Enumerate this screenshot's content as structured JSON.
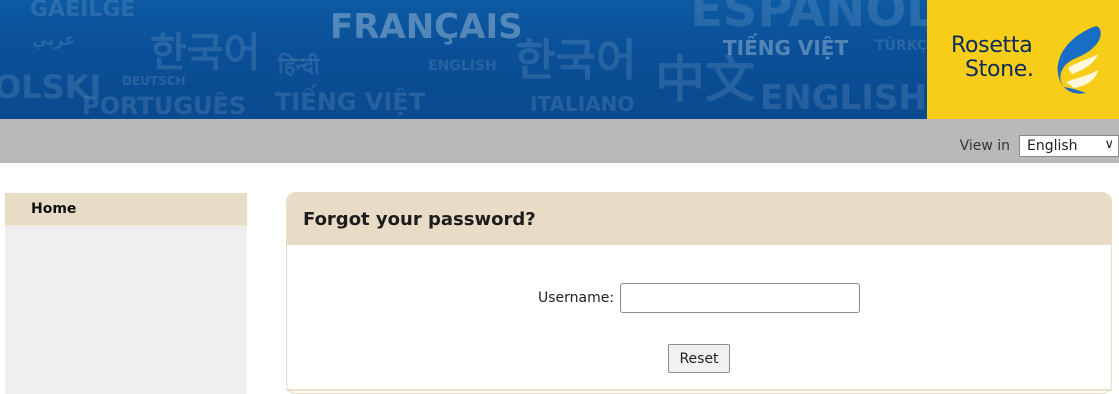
{
  "banner": {
    "background_words": [
      "GAEILGE",
      "عربي",
      "한국어",
      "हिन्दी",
      "FRANÇAIS",
      "ENGLISH",
      "한국어",
      "ESPAÑOL",
      "TIẾNG VIỆT",
      "TÜRKÇE",
      "中文",
      "ENGLISH",
      "OLSKI",
      "DEUTSCH",
      "PORTUGUÊS",
      "TIẾNG VIỆT",
      "ITALIANO"
    ],
    "logo": {
      "line1": "Rosetta",
      "line2": "Stone.",
      "icon": "rosetta-stone-logo-icon"
    }
  },
  "topbar": {
    "view_in_label": "View in",
    "language_selected": "English"
  },
  "sidebar": {
    "items": [
      {
        "label": "Home"
      }
    ]
  },
  "form": {
    "title": "Forgot your password?",
    "username_label": "Username:",
    "username_value": "",
    "reset_label": "Reset"
  },
  "colors": {
    "banner_blue": "#0a4f97",
    "logo_yellow": "#f7cd18",
    "gray_bar": "#b9b9b9",
    "beige": "#e8dcc6"
  }
}
